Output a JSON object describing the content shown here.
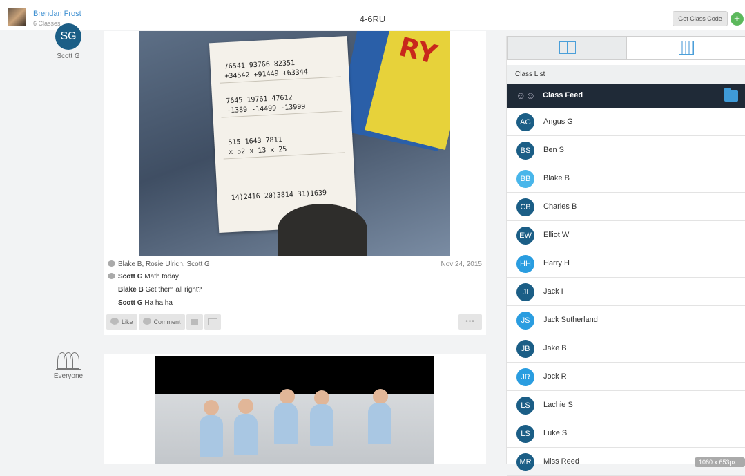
{
  "header": {
    "teacher_name": "Brendan Frost",
    "teacher_classes": "6 Classes",
    "class_title": "4-6RU",
    "get_class_code": "Get Class Code",
    "add_icon": "plus-icon"
  },
  "posts": [
    {
      "poster_initials": "SG",
      "poster_name": "Scott G",
      "likes": "Blake B, Rosie Ulrich, Scott G",
      "date": "Nov 24, 2015",
      "comments": [
        {
          "author": "Scott G",
          "text": "Math today"
        },
        {
          "author": "Blake B",
          "text": "Get them all right?"
        },
        {
          "author": "Scott G",
          "text": "Ha ha ha"
        }
      ],
      "actions": {
        "like": "Like",
        "comment": "Comment",
        "more": "•••"
      }
    },
    {
      "poster_name": "Everyone",
      "poster_icon": "group-icon"
    }
  ],
  "sidebar": {
    "class_list_label": "Class List",
    "class_feed_label": "Class Feed",
    "students": [
      {
        "initials": "AG",
        "name": "Angus G",
        "color": "#1b5e86"
      },
      {
        "initials": "BS",
        "name": "Ben S",
        "color": "#1b5e86"
      },
      {
        "initials": "BB",
        "name": "Blake B",
        "color": "#49b6ea"
      },
      {
        "initials": "CB",
        "name": "Charles B",
        "color": "#1b5e86"
      },
      {
        "initials": "EW",
        "name": "Elliot W",
        "color": "#1b5e86"
      },
      {
        "initials": "HH",
        "name": "Harry H",
        "color": "#2a9de0"
      },
      {
        "initials": "JI",
        "name": "Jack I",
        "color": "#1b5e86"
      },
      {
        "initials": "JS",
        "name": "Jack Sutherland",
        "color": "#2a9de0"
      },
      {
        "initials": "JB",
        "name": "Jake B",
        "color": "#1b5e86"
      },
      {
        "initials": "JR",
        "name": "Jock R",
        "color": "#2a9de0"
      },
      {
        "initials": "LS",
        "name": "Lachie S",
        "color": "#1b5e86"
      },
      {
        "initials": "LS",
        "name": "Luke S",
        "color": "#1b5e86"
      },
      {
        "initials": "MR",
        "name": "Miss Reed",
        "color": "#1b5e86"
      }
    ]
  },
  "overlay": {
    "dimension_tag": "1060 x 653px"
  }
}
